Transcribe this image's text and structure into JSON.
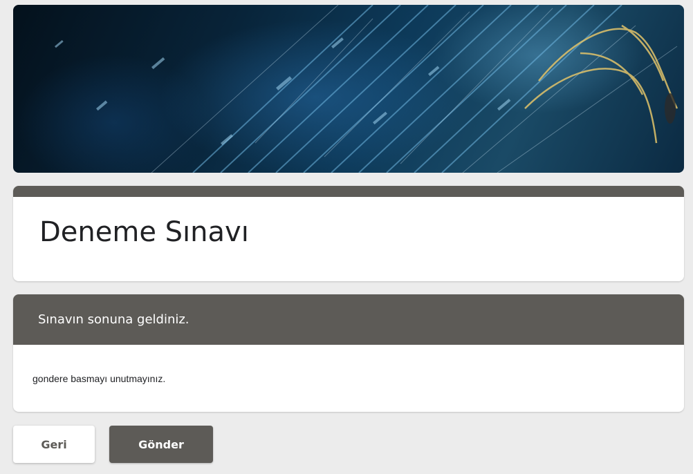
{
  "form": {
    "title": "Deneme Sınavı"
  },
  "section": {
    "title": "Sınavın sonuna geldiniz.",
    "description": "gondere basmayı unutmayınız."
  },
  "buttons": {
    "back_label": "Geri",
    "submit_label": "Gönder"
  },
  "colors": {
    "theme": "#5d5b57",
    "background": "#ececec",
    "card": "#ffffff"
  }
}
